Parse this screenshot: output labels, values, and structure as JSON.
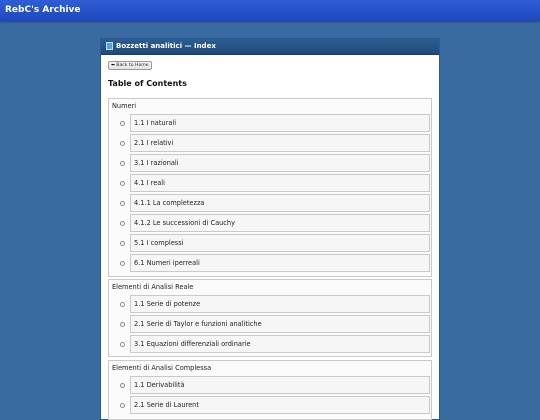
{
  "site": {
    "title": "RebC's Archive"
  },
  "window": {
    "title": "Bozzetti analitici — Index",
    "icon": "book-icon"
  },
  "back_button": {
    "label": "⬅ Back to Home"
  },
  "toc": {
    "title": "Table of Contents",
    "sections": [
      {
        "title": "Numeri",
        "items": [
          "1.1 I naturali",
          "2.1 I relativi",
          "3.1 I razionali",
          "4.1 I reali",
          "4.1.1 La completezza",
          "4.1.2 Le successioni di Cauchy",
          "5.1 I complessi",
          "6.1 Numeri iperreali"
        ]
      },
      {
        "title": "Elementi di Analisi Reale",
        "items": [
          "1.1 Serie di potenze",
          "2.1 Serie di Taylor e funzioni analitiche",
          "3.1 Equazioni differenziali ordinarie"
        ]
      },
      {
        "title": "Elementi di Analisi Complessa",
        "items": [
          "1.1 Derivabilità",
          "2.1 Serie di Laurent"
        ]
      }
    ]
  },
  "colors": {
    "background": "#3a6ba0",
    "topbar": "#2454cc",
    "window_header": "#27548a"
  }
}
